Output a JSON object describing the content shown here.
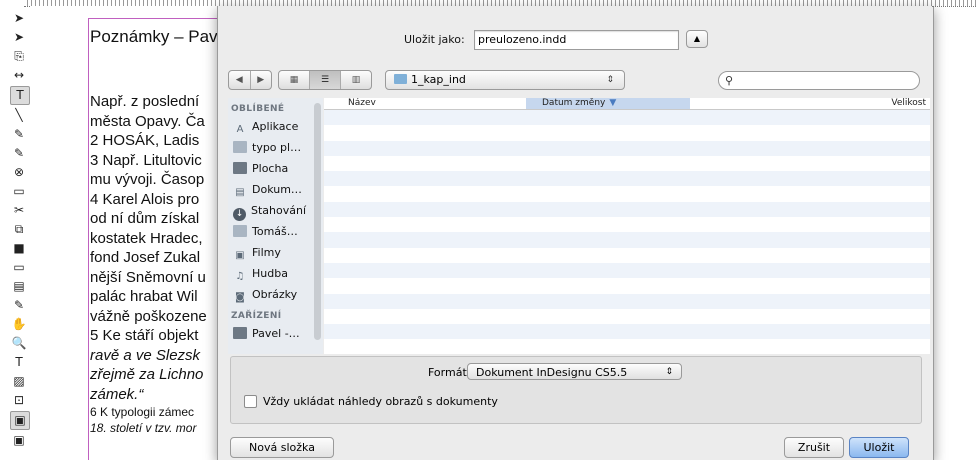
{
  "toolbar": {
    "tools": [
      "➤",
      "➤",
      "⎘",
      "↔",
      "T",
      "╲",
      "✎",
      "✎",
      "⊗",
      "▭",
      "✂",
      "⧉",
      "■",
      "▭",
      "▤",
      "✎",
      "✋",
      "🔍",
      "T",
      "▨",
      "⊡",
      "▣",
      "▣"
    ]
  },
  "document": {
    "title": "Poznámky – Pav",
    "lines": [
      " Např. z poslední",
      "města Opavy. Ča",
      "2 HOSÁK, Ladis",
      "3 Např. Litultovic",
      "mu vývoji. Časop",
      "4 Karel Alois pro",
      "od ní dům získal",
      "kostatek Hradec,",
      "fond Josef Zukal",
      "nější Sněmovní u",
      "palác hrabat Wil",
      "vážně poškozene",
      "5 Ke stáří objekt",
      "ravě a ve Slezsk",
      "zřejmě za Lichno",
      "zámek.“"
    ],
    "small_lines": [
      "6 K typologii zámec",
      "18. století v tzv. mor"
    ]
  },
  "dialog": {
    "saveas_label": "Uložit jako:",
    "filename": "preulozeno.indd",
    "folder": "1_kap_ind",
    "search_placeholder": "",
    "sidebar": {
      "favorites_header": "OBLÍBENÉ",
      "favorites": [
        {
          "label": "Aplikace",
          "icon": "app-icon"
        },
        {
          "label": "typo pl…",
          "icon": "folder-icon"
        },
        {
          "label": "Plocha",
          "icon": "desktop-icon"
        },
        {
          "label": "Dokum…",
          "icon": "documents-icon"
        },
        {
          "label": "Stahování",
          "icon": "downloads-icon"
        },
        {
          "label": "Tomáš…",
          "icon": "folder-icon"
        },
        {
          "label": "Filmy",
          "icon": "movies-icon"
        },
        {
          "label": "Hudba",
          "icon": "music-icon"
        },
        {
          "label": "Obrázky",
          "icon": "pictures-icon"
        }
      ],
      "devices_header": "ZAŘÍZENÍ",
      "devices": [
        {
          "label": "Pavel -…",
          "icon": "computer-icon"
        }
      ]
    },
    "columns": {
      "name": "Název",
      "date": "Datum změny",
      "size": "Velikost"
    },
    "format_label": "Formát:",
    "format_value": "Dokument InDesignu CS5.5",
    "checkbox_label": "Vždy ukládat náhledy obrazů s dokumenty",
    "checkbox_checked": false,
    "new_folder_button": "Nová složka",
    "cancel_button": "Zrušit",
    "save_button": "Uložit"
  }
}
